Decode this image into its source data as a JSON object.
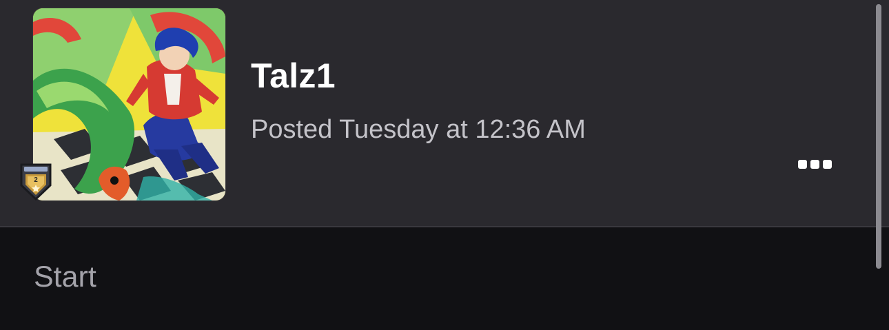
{
  "post": {
    "author": "Talz1",
    "posted_time": "Posted Tuesday at 12:36 AM",
    "content": "Start",
    "rank_badge_level": "2",
    "more_icon": "ellipsis-icon"
  },
  "colors": {
    "header_bg": "#2a292e",
    "body_bg": "#111114",
    "username": "#ffffff",
    "timestamp": "#c4c3c9",
    "content_text": "#a4a3aa",
    "scrollbar": "#8c8b91"
  }
}
